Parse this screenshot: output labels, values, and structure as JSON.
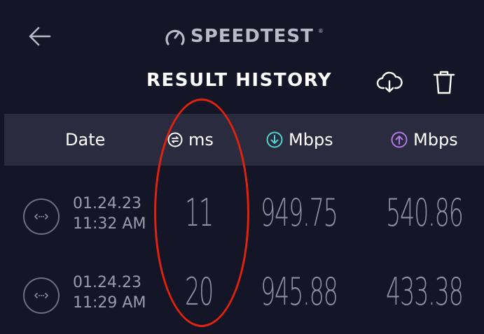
{
  "header": {
    "brand": "SPEEDTEST",
    "brand_mark": "®",
    "title": "RESULT HISTORY"
  },
  "icons": {
    "back": "back-arrow-icon",
    "brand": "gauge-icon",
    "cloud": "cloud-download-icon",
    "trash": "trash-icon",
    "ping": "ping-icon",
    "download": "download-icon",
    "upload": "upload-icon",
    "connection": "connection-icon"
  },
  "colors": {
    "background": "#141526",
    "header_row": "#2a2b3f",
    "download_accent": "#4fd4cc",
    "upload_accent": "#b07ae6",
    "annotation": "#e0220f"
  },
  "table": {
    "columns": {
      "date": "Date",
      "ping": "ms",
      "download": "Mbps",
      "upload": "Mbps"
    },
    "rows": [
      {
        "date": "01.24.23",
        "time": "11:32 AM",
        "ping": "11",
        "download": "949.75",
        "upload": "540.86"
      },
      {
        "date": "01.24.23",
        "time": "11:29 AM",
        "ping": "20",
        "download": "945.88",
        "upload": "433.38"
      }
    ]
  }
}
